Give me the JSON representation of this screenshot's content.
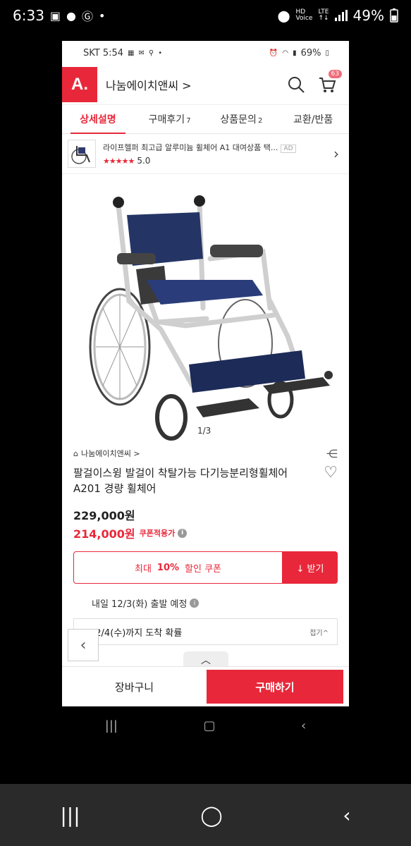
{
  "outer_status": {
    "time": "6:33",
    "hd_label": "HD",
    "voice_label": "Voice",
    "lte_label": "LTE",
    "battery": "49%"
  },
  "inner_status": {
    "carrier_time": "SKT 5:54",
    "battery": "69%"
  },
  "header": {
    "logo_text": "A.",
    "store_name": "나눔에이치앤씨 >",
    "cart_count": "63"
  },
  "tabs": [
    {
      "label": "상세설명",
      "count": ""
    },
    {
      "label": "구매후기",
      "count": "7"
    },
    {
      "label": "상품문의",
      "count": "2"
    },
    {
      "label": "교환/반품",
      "count": ""
    }
  ],
  "ad": {
    "title": "라이프헬퍼 최고급 알루미늄 휠체어 A1 대여상품 택...",
    "tag": "AD",
    "stars": "★★★★★",
    "rating": "5.0"
  },
  "gallery": {
    "counter": "1/3"
  },
  "product": {
    "brand": "나눔에이치앤씨 >",
    "title": "팔걸이스윙 발걸이 착탈가능 다기능분리형휠체어 A201 경량 휠체어",
    "price_original": "229,000원",
    "price_sale": "214,000원",
    "coupon_note": "쿠폰적용가"
  },
  "coupon": {
    "prefix": "최대",
    "percent": "10%",
    "suffix": "할인 쿠폰",
    "button": "↓ 받기"
  },
  "shipping": {
    "departure": "내일 12/3(화) 출발 예정",
    "arrival": "12/4(수)까지 도착 확률",
    "fold": "접기^"
  },
  "bottom_bar": {
    "cart_label": "장바구니",
    "buy_label": "구매하기"
  },
  "colors": {
    "accent": "#e8283a"
  }
}
